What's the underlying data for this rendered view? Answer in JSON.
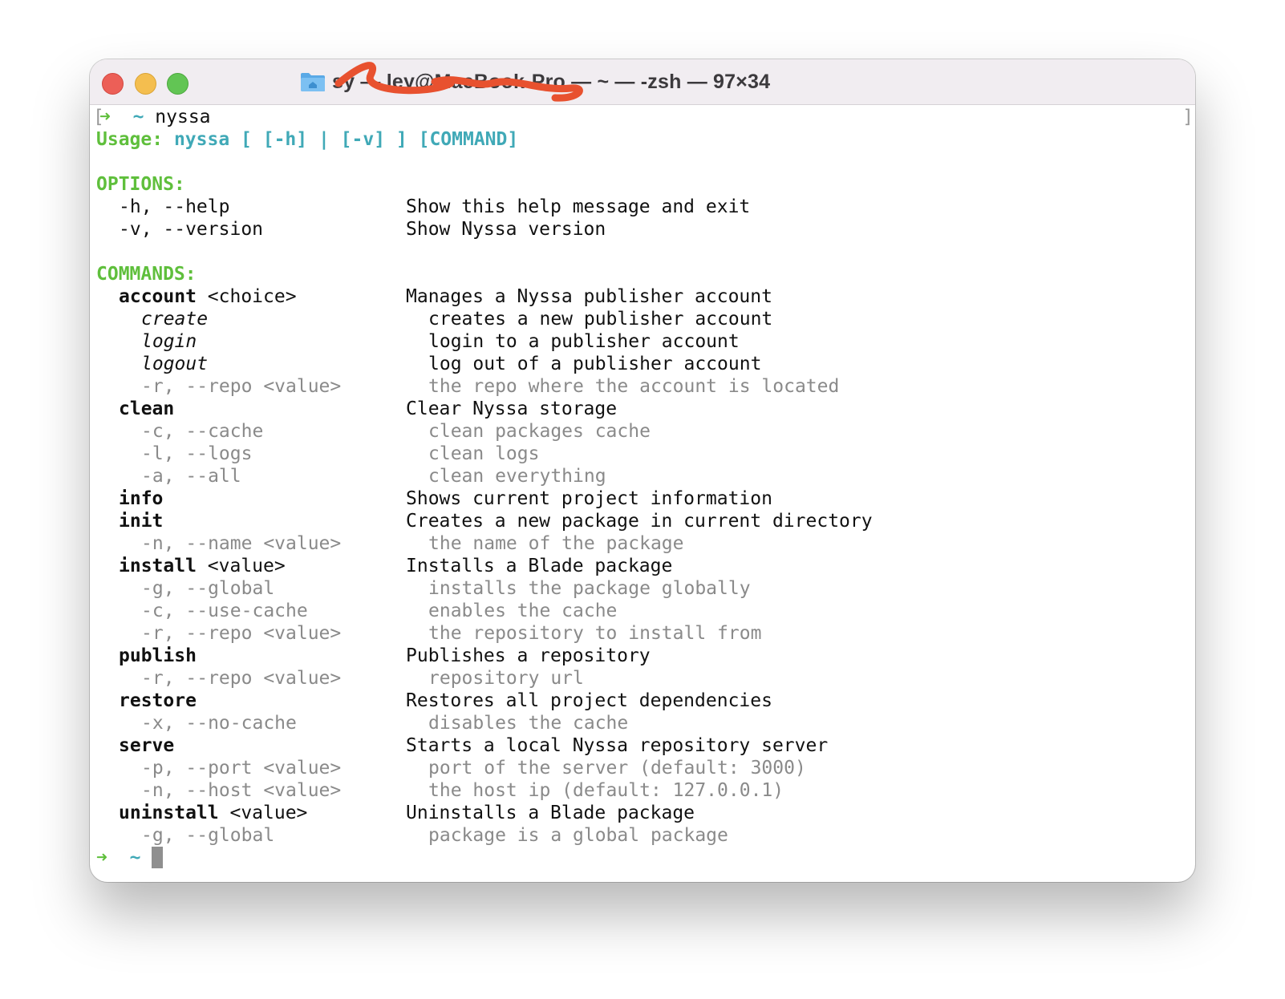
{
  "window": {
    "title_visible_fragments": [
      "sy —",
      "ley@MacBook-Pro — ~ — -zsh — 97×34"
    ],
    "title": "sy — ley@MacBook-Pro — ~ — -zsh — 97×34",
    "traffic_lights": {
      "close": "#ec5f57",
      "minimize": "#f4be4f",
      "zoom": "#62c554"
    }
  },
  "terminal": {
    "prompt_arrow": "➜",
    "prompt_dir": "~",
    "command": "nyssa",
    "usage_label": "Usage:",
    "usage_text": "nyssa [ [-h] | [-v] ] [COMMAND]",
    "options_header": "OPTIONS:",
    "options": [
      {
        "flag": "-h, --help",
        "desc": "Show this help message and exit"
      },
      {
        "flag": "-v, --version",
        "desc": "Show Nyssa version"
      }
    ],
    "commands_header": "COMMANDS:",
    "commands": [
      {
        "name": "account",
        "arg": " <choice>",
        "desc": "Manages a Nyssa publisher account",
        "choices": [
          {
            "name": "create",
            "desc": "creates a new publisher account"
          },
          {
            "name": "login",
            "desc": "login to a publisher account"
          },
          {
            "name": "logout",
            "desc": "log out of a publisher account"
          }
        ],
        "flags": [
          {
            "flag": "-r, --repo <value>",
            "desc": "the repo where the account is located"
          }
        ]
      },
      {
        "name": "clean",
        "arg": "",
        "desc": "Clear Nyssa storage",
        "choices": [],
        "flags": [
          {
            "flag": "-c, --cache",
            "desc": "clean packages cache"
          },
          {
            "flag": "-l, --logs",
            "desc": "clean logs"
          },
          {
            "flag": "-a, --all",
            "desc": "clean everything"
          }
        ]
      },
      {
        "name": "info",
        "arg": "",
        "desc": "Shows current project information",
        "choices": [],
        "flags": []
      },
      {
        "name": "init",
        "arg": "",
        "desc": "Creates a new package in current directory",
        "choices": [],
        "flags": [
          {
            "flag": "-n, --name <value>",
            "desc": "the name of the package"
          }
        ]
      },
      {
        "name": "install",
        "arg": " <value>",
        "desc": "Installs a Blade package",
        "choices": [],
        "flags": [
          {
            "flag": "-g, --global",
            "desc": "installs the package globally"
          },
          {
            "flag": "-c, --use-cache",
            "desc": "enables the cache"
          },
          {
            "flag": "-r, --repo <value>",
            "desc": "the repository to install from"
          }
        ]
      },
      {
        "name": "publish",
        "arg": "",
        "desc": "Publishes a repository",
        "choices": [],
        "flags": [
          {
            "flag": "-r, --repo <value>",
            "desc": "repository url"
          }
        ]
      },
      {
        "name": "restore",
        "arg": "",
        "desc": "Restores all project dependencies",
        "choices": [],
        "flags": [
          {
            "flag": "-x, --no-cache",
            "desc": "disables the cache"
          }
        ]
      },
      {
        "name": "serve",
        "arg": "",
        "desc": "Starts a local Nyssa repository server",
        "choices": [],
        "flags": [
          {
            "flag": "-p, --port <value>",
            "desc": "port of the server (default: 3000)"
          },
          {
            "flag": "-n, --host <value>",
            "desc": "the host ip (default: 127.0.0.1)"
          }
        ]
      },
      {
        "name": "uninstall",
        "arg": " <value>",
        "desc": "Uninstalls a Blade package",
        "choices": [],
        "flags": [
          {
            "flag": "-g, --global",
            "desc": "package is a global package"
          }
        ]
      }
    ],
    "colors": {
      "green": "#5fbf3c",
      "cyan": "#40a9b7",
      "dim": "#8a8a8a"
    }
  }
}
